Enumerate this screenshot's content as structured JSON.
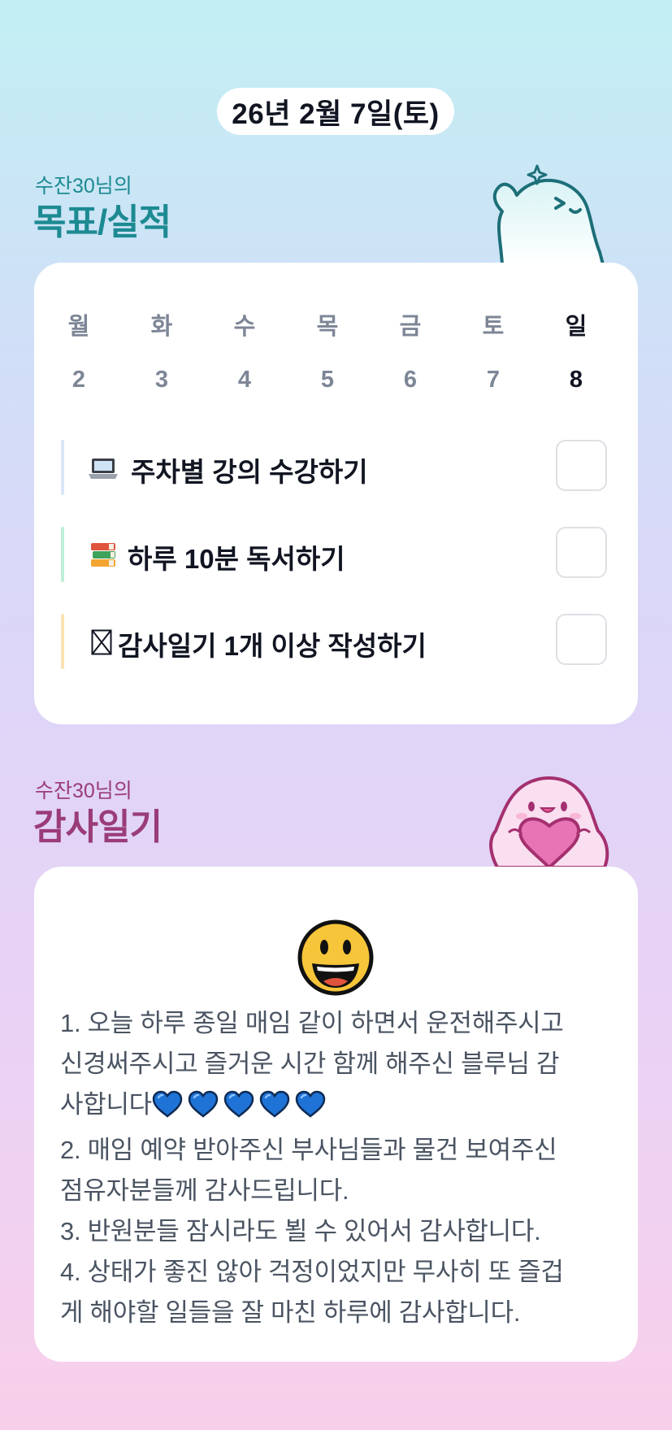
{
  "date": "26년 2월 7일(토)",
  "goals_section": {
    "subtitle": "수잔30님의",
    "title": "목표/실적"
  },
  "week": {
    "days": [
      "월",
      "화",
      "수",
      "목",
      "금",
      "토",
      "일"
    ],
    "dates": [
      "2",
      "3",
      "4",
      "5",
      "6",
      "7",
      "8"
    ],
    "today_index": 6
  },
  "goals": [
    {
      "icon": "laptop-icon",
      "label": "주차별 강의 수강하기",
      "bar_color": "#d8e6f7",
      "checked": false
    },
    {
      "icon": "books-icon",
      "label": "하루 10분 독서하기",
      "bar_color": "#bfeed9",
      "checked": false
    },
    {
      "icon": "missing-glyph-icon",
      "label": "감사일기 1개 이상 작성하기",
      "bar_color": "#fbe1b3",
      "checked": false
    }
  ],
  "diary_section": {
    "subtitle": "수잔30님의",
    "title": "감사일기"
  },
  "diary": {
    "mood_icon": "grinning-face-icon",
    "lines": [
      "1. 오늘 하루 종일 매임 같이 하면서 운전해주시고",
      "신경써주시고 즐거운 시간 함께 해주신 블루님 감",
      "사합니다",
      "2. 매임 예약 받아주신 부사님들과 물건 보여주신",
      "점유자분들께 감사드립니다.",
      "3. 반원분들 잠시라도 뵐 수 있어서 감사합니다.",
      "4. 상태가 좋진 않아 걱정이었지만 무사히 또 즐겁",
      "게 해야할 일들을 잘 마친 하루에 감사합니다."
    ],
    "heart_icon": "blue-heart-icon",
    "heart_count": 5
  },
  "colors": {
    "accent_teal": "#1d8a92",
    "accent_pink": "#9a3c78",
    "heart_blue": "#1f73d6"
  }
}
